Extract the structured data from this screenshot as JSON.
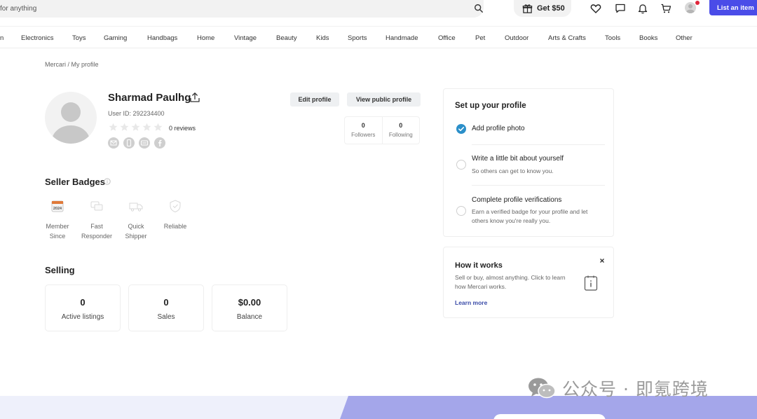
{
  "header": {
    "search_placeholder": "for anything",
    "promo_label": "Get $50",
    "list_button": "List an item",
    "icons": [
      "search-icon",
      "gift-icon",
      "heart-icon",
      "chat-icon",
      "bell-icon",
      "cart-icon",
      "avatar"
    ]
  },
  "categories": [
    "n",
    "Electronics",
    "Toys",
    "Gaming",
    "Handbags",
    "Home",
    "Vintage",
    "Beauty",
    "Kids",
    "Sports",
    "Handmade",
    "Office",
    "Pet",
    "Outdoor",
    "Arts & Crafts",
    "Tools",
    "Books",
    "Other"
  ],
  "breadcrumb": "Mercari / My profile",
  "profile": {
    "name": "Sharmad Paulhg",
    "user_id": "User ID: 292234400",
    "reviews": "0 reviews",
    "rating": 0,
    "edit_button": "Edit profile",
    "public_button": "View public profile",
    "followers_count": "0",
    "followers_label": "Followers",
    "following_count": "0",
    "following_label": "Following"
  },
  "badges": {
    "title": "Seller Badges",
    "items": [
      {
        "label": "Member\nSince",
        "icon": "calendar-icon",
        "icon_text": "2024"
      },
      {
        "label": "Fast\nResponder",
        "icon": "chat-bubbles-icon"
      },
      {
        "label": "Quick\nShipper",
        "icon": "truck-icon"
      },
      {
        "label": "Reliable",
        "icon": "shield-icon"
      }
    ]
  },
  "selling": {
    "title": "Selling",
    "stats": [
      {
        "value": "0",
        "label": "Active listings"
      },
      {
        "value": "0",
        "label": "Sales"
      },
      {
        "value": "$0.00",
        "label": "Balance"
      }
    ]
  },
  "setup": {
    "title": "Set up your profile",
    "tasks": [
      {
        "title": "Add profile photo",
        "desc": "",
        "done": true
      },
      {
        "title": "Write a little bit about yourself",
        "desc": "So others can get to know you.",
        "done": false
      },
      {
        "title": "Complete profile verifications",
        "desc": "Earn a verified badge for your profile and let others know you're really you.",
        "done": false
      }
    ]
  },
  "how": {
    "title": "How it works",
    "desc": "Sell or buy, almost anything. Click to learn how Mercari works.",
    "link": "Learn more"
  },
  "watermark": "公众号 · 即氪跨境",
  "colors": {
    "accent": "#4a4ce8",
    "check": "#2b8fc9",
    "link": "#3a4ba8",
    "footer": "#a4a6ea"
  }
}
